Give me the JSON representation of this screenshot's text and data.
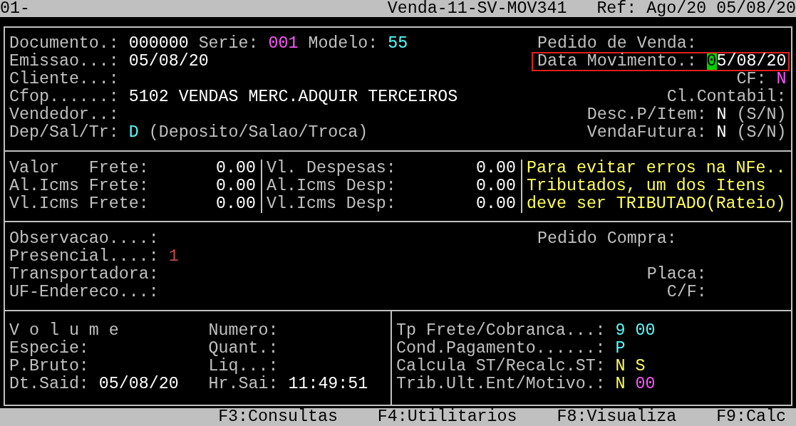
{
  "header": {
    "session": "01-",
    "program": "Venda-11-SV-MOV341",
    "reference": "Ref: Ago/20 05/08/20"
  },
  "document": {
    "left": [
      {
        "fields": [
          {
            "label": "Documento.:",
            "values": [
              {
                "text": "000000",
                "color": "#ffffff"
              }
            ]
          },
          {
            "label": "Serie:",
            "values": [
              {
                "text": "001",
                "color": "#ff55ff"
              }
            ]
          },
          {
            "label": "Modelo:",
            "values": [
              {
                "text": "55",
                "color": "#55ffff"
              }
            ]
          }
        ]
      },
      {
        "fields": [
          {
            "label": "Emissao...:",
            "values": [
              {
                "text": "05/08/20",
                "color": "#ffffff"
              }
            ]
          }
        ]
      },
      {
        "fields": [
          {
            "label": "Cliente...:"
          }
        ]
      },
      {
        "fields": [
          {
            "label": "Cfop......:",
            "values": [
              {
                "text": "5102",
                "color": "#ffffff"
              },
              {
                "text": "VENDAS MERC.ADQUIR TERCEIROS",
                "color": "#ffffff"
              }
            ]
          }
        ]
      },
      {
        "fields": [
          {
            "label": "Vendedor..:"
          }
        ]
      },
      {
        "fields": [
          {
            "label": "Dep/Sal/Tr:",
            "values": [
              {
                "text": "D",
                "color": "#55ffff"
              },
              {
                "text": "(Deposito/Salao/Troca)",
                "color": "#c0c0c0"
              }
            ]
          }
        ]
      }
    ],
    "right": [
      {
        "fields": [
          {
            "label": "Pedido de Venda:"
          }
        ]
      },
      {
        "highlighted": true,
        "fields": [
          {
            "label": "Data Movimento.:",
            "cursor": true,
            "values": [
              {
                "text": "05/08/20"
              }
            ]
          }
        ]
      },
      {
        "fields": [
          {
            "label": "CF:",
            "values": [
              {
                "text": "N",
                "color": "#ff55ff"
              }
            ]
          }
        ]
      },
      {
        "fields": [
          {
            "label": "Cl.Contabil:"
          }
        ]
      },
      {
        "fields": [
          {
            "label": "Desc.P/Item:",
            "values": [
              {
                "text": "N",
                "color": "#ffffff"
              },
              {
                "text": "(S/N)",
                "color": "#c0c0c0"
              }
            ]
          }
        ]
      },
      {
        "fields": [
          {
            "label": "VendaFutura:",
            "values": [
              {
                "text": "N",
                "color": "#ffffff"
              },
              {
                "text": "(S/N)",
                "color": "#c0c0c0"
              }
            ]
          }
        ]
      }
    ]
  },
  "totals": {
    "freight": [
      {
        "label": "Valor   Frete:",
        "amount": "0.00"
      },
      {
        "label": "Al.Icms Frete:",
        "amount": "0.00"
      },
      {
        "label": "Vl.Icms Frete:",
        "amount": "0.00"
      }
    ],
    "expenses": [
      {
        "label": "Vl. Despesas:",
        "amount": "0.00"
      },
      {
        "label": "Al.Icms Desp:",
        "amount": "0.00"
      },
      {
        "label": "Vl.Icms Desp:",
        "amount": "0.00"
      }
    ],
    "notice": [
      "Para evitar erros na NFe..",
      "Tributados, um dos Itens",
      "deve ser TRIBUTADO(Rateio)"
    ]
  },
  "shipping": {
    "left": [
      {
        "fields": [
          {
            "label": "Observacao....:"
          }
        ]
      },
      {
        "fields": [
          {
            "label": "Presencial....:",
            "values": [
              {
                "text": "1",
                "color": "#c04848"
              }
            ]
          }
        ]
      },
      {
        "fields": [
          {
            "label": "Transportadora:"
          }
        ]
      },
      {
        "fields": [
          {
            "label": "UF-Endereco...:"
          }
        ]
      }
    ],
    "right": [
      {
        "fields": [
          {
            "label": "Pedido Compra:"
          }
        ]
      },
      {
        "fields": [
          {
            "label": "Placa:"
          }
        ]
      },
      {
        "fields": [
          {
            "label": "C/F:"
          }
        ]
      }
    ]
  },
  "volume": {
    "left": [
      {
        "fields": [
          {
            "label": "V o l u m e"
          },
          {
            "label": "Numero:"
          }
        ]
      },
      {
        "fields": [
          {
            "label": "Especie:"
          },
          {
            "label": "Quant.:"
          }
        ]
      },
      {
        "fields": [
          {
            "label": "P.Bruto:"
          },
          {
            "label": "Liq...:"
          }
        ]
      },
      {
        "fields": [
          {
            "label": "Dt.Said:",
            "values": [
              {
                "text": "05/08/20",
                "color": "#ffffff"
              }
            ]
          },
          {
            "label": "Hr.Sai:",
            "values": [
              {
                "text": "11:49:51",
                "color": "#ffffff"
              }
            ]
          }
        ]
      }
    ],
    "right": [
      {
        "fields": [
          {
            "label": "Tp Frete/Cobranca...:",
            "values": [
              {
                "text": "9",
                "color": "#55ffff"
              },
              {
                "text": "00",
                "color": "#55ffff"
              }
            ]
          }
        ]
      },
      {
        "fields": [
          {
            "label": "Cond.Pagamento......:",
            "values": [
              {
                "text": "P",
                "color": "#55ffff"
              }
            ]
          }
        ]
      },
      {
        "fields": [
          {
            "label": "Calcula ST/Recalc.ST:",
            "values": [
              {
                "text": "N",
                "color": "#ffff55"
              },
              {
                "text": "S",
                "color": "#ffff55"
              }
            ]
          }
        ]
      },
      {
        "fields": [
          {
            "label": "Trib.Ult.Ent/Motivo.:",
            "values": [
              {
                "text": "N",
                "color": "#ffff55"
              },
              {
                "text": "00",
                "color": "#ff55ff"
              }
            ]
          }
        ]
      }
    ]
  },
  "function_keys": [
    "F3:Consultas",
    "F4:Utilitarios",
    "F8:Visualiza",
    "F9:Calc"
  ]
}
